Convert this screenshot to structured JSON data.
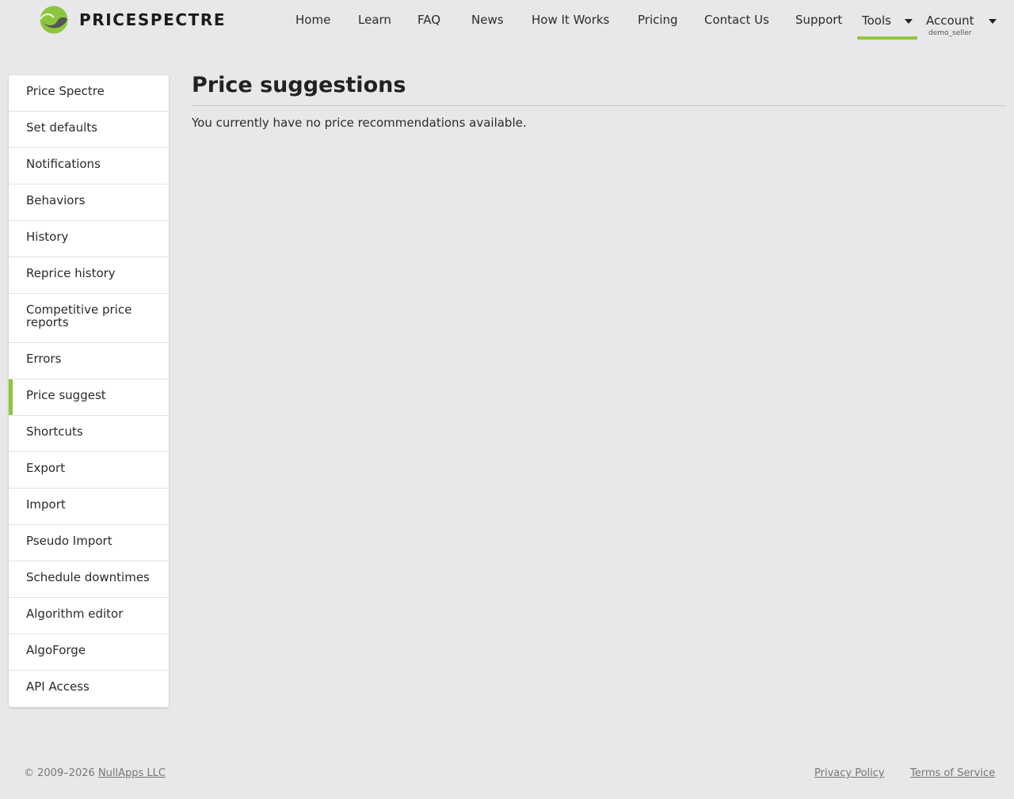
{
  "brand": {
    "name": "PRICESPECTRE",
    "colors": {
      "accent": "#8cc63f",
      "logo_dark": "#555555"
    }
  },
  "nav": {
    "home": "Home",
    "learn": "Learn",
    "faq": "FAQ",
    "news": "News",
    "how_it_works": "How It Works",
    "pricing": "Pricing",
    "contact": "Contact Us",
    "support": "Support",
    "tools": "Tools",
    "account": "Account",
    "account_user": "demo_seller"
  },
  "sidebar": {
    "items": [
      {
        "label": "Price Spectre"
      },
      {
        "label": "Set defaults"
      },
      {
        "label": "Notifications"
      },
      {
        "label": "Behaviors"
      },
      {
        "label": "History"
      },
      {
        "label": "Reprice history"
      },
      {
        "label": "Competitive price reports"
      },
      {
        "label": "Errors"
      },
      {
        "label": "Price suggest",
        "active": true
      },
      {
        "label": "Shortcuts"
      },
      {
        "label": "Export"
      },
      {
        "label": "Import"
      },
      {
        "label": "Pseudo Import"
      },
      {
        "label": "Schedule downtimes"
      },
      {
        "label": "Algorithm editor"
      },
      {
        "label": "AlgoForge"
      },
      {
        "label": "API Access"
      }
    ]
  },
  "main": {
    "title": "Price suggestions",
    "message": "You currently have no price recommendations available."
  },
  "footer": {
    "copyright_prefix": "© 2009–2026 ",
    "company": "NullApps LLC",
    "privacy": "Privacy Policy",
    "terms": "Terms of Service"
  }
}
